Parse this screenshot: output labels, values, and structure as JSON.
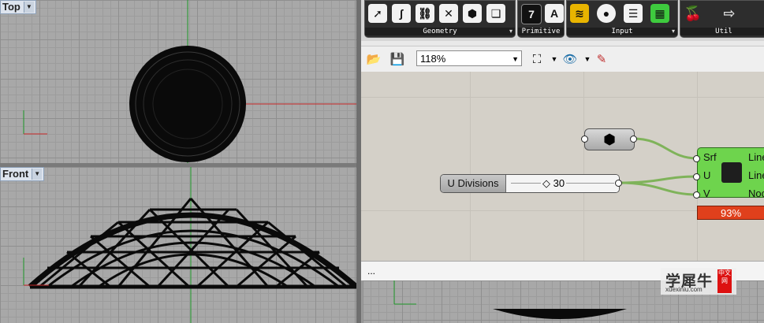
{
  "viewports": {
    "top": {
      "label": "Top"
    },
    "front": {
      "label": "Front"
    }
  },
  "toolbar": {
    "groups": [
      {
        "label": "Geometry",
        "icons": [
          "arrow-tool-icon",
          "curve-icon",
          "link-icon",
          "cross-icon",
          "sphere-icon",
          "pages-icon"
        ]
      },
      {
        "label": "Primitive",
        "icons": [
          "number-7-icon",
          "letter-a-icon"
        ]
      },
      {
        "label": "Input",
        "icons": [
          "graph-icon",
          "circle-icon",
          "list-icon",
          "grid-icon"
        ]
      },
      {
        "label": "Util",
        "icons": [
          "cherries-icon",
          "arrow-right-icon"
        ]
      }
    ],
    "glyphs": {
      "n7": "7",
      "A": "A",
      "cherry": "🍒",
      "arrow": "⇨"
    }
  },
  "canvas_bar": {
    "zoom": "118%"
  },
  "canvas": {
    "slider": {
      "name": "U Divisions",
      "value": "30",
      "marker": "◇"
    },
    "component": {
      "inputs": [
        "Srf",
        "U",
        "V"
      ],
      "outputs": [
        "Line",
        "Line",
        "Noc"
      ],
      "progress": 0.93,
      "progress_label": "93%"
    }
  },
  "status": {
    "text": "..."
  },
  "watermark": {
    "cn": "学犀牛",
    "badge": "中文网",
    "url": "xuexiniu.com"
  },
  "colors": {
    "wire": "#7fb35a",
    "component": "#6ed44d",
    "progress": "#e0401c",
    "x_axis": "#c82828",
    "y_axis": "#1f9a2a"
  }
}
